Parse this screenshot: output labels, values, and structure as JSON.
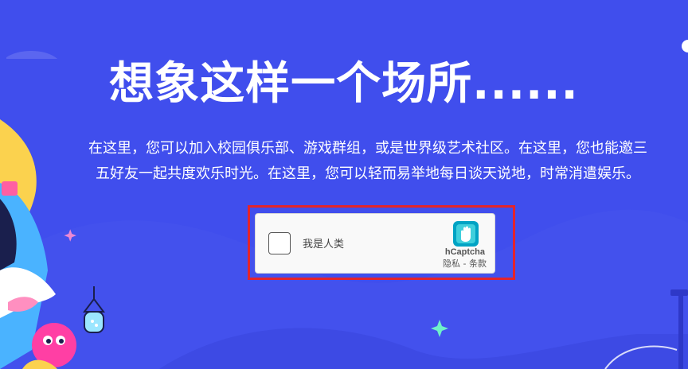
{
  "hero": {
    "title": "想象这样一个场所......",
    "description_line1": "在这里，您可以加入校园俱乐部、游戏群组，或是世界级艺术社区。在这里，您也能邀三",
    "description_line2": "五好友一起共度欢乐时光。在这里，您可以轻而易举地每日谈天说地，时常消遣娱乐。"
  },
  "captcha": {
    "checkbox_label": "我是人类",
    "brand": "hCaptcha",
    "privacy_link": "隐私",
    "separator": " - ",
    "terms_link": "条款"
  },
  "colors": {
    "background": "#404eed",
    "highlight_border": "#e3242b"
  }
}
